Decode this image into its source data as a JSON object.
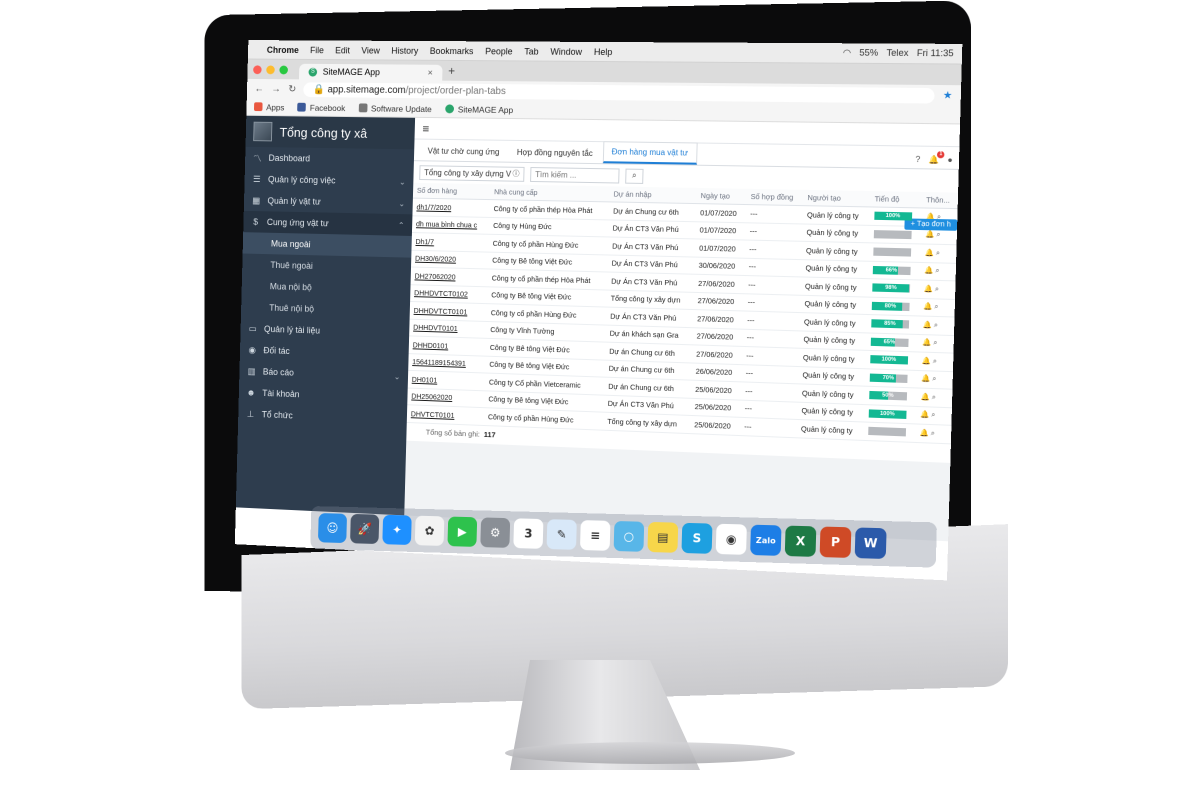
{
  "menubar": {
    "apple": "",
    "items": [
      "Chrome",
      "File",
      "Edit",
      "View",
      "History",
      "Bookmarks",
      "People",
      "Tab",
      "Window",
      "Help"
    ],
    "battery": "55%",
    "time": "Fri 11:35",
    "wifi_label": "Telex"
  },
  "browser": {
    "tab_title": "SiteMAGE App",
    "tab_close": "×",
    "new_tab": "+",
    "url_domain": "app.sitemage.com",
    "url_path": "/project/order-plan-tabs",
    "bookmarks": [
      "Apps",
      "Facebook",
      "Software Update",
      "SiteMAGE App"
    ]
  },
  "sidebar": {
    "brand": "Tổng công ty xâ",
    "items": [
      {
        "label": "Dashboard",
        "icon": "chart-line-icon"
      },
      {
        "label": "Quản lý công việc",
        "icon": "tasks-icon",
        "chevron": "⌄"
      },
      {
        "label": "Quản lý vật tư",
        "icon": "grid-icon",
        "chevron": "⌄"
      },
      {
        "label": "Cung ứng vật tư",
        "icon": "dollar-icon",
        "chevron": "⌃"
      }
    ],
    "subitems": [
      "Mua ngoài",
      "Thuê ngoài",
      "Mua nội bộ",
      "Thuê nội bộ"
    ],
    "items2": [
      {
        "label": "Quản lý tài liệu",
        "icon": "document-icon"
      },
      {
        "label": "Đối tác",
        "icon": "user-circle-icon"
      },
      {
        "label": "Báo cáo",
        "icon": "bar-chart-icon",
        "chevron": "⌄"
      },
      {
        "label": "Tài khoản",
        "icon": "users-icon"
      },
      {
        "label": "Tổ chức",
        "icon": "sitemap-icon"
      }
    ]
  },
  "main": {
    "tabs": [
      "Vật tư chờ cung ứng",
      "Hợp đồng nguyên tắc",
      "Đơn hàng mua vật tư"
    ],
    "filter_select": "Tổng công ty xây dựng V",
    "search_placeholder": "Tìm kiếm ...",
    "create_button": "+ Tạo đơn h",
    "columns": [
      "Số đơn hàng",
      "Nhà cung cấp",
      "Dự án nhập",
      "Ngày tạo",
      "Số hợp đồng",
      "Người tạo",
      "Tiến độ",
      "Thôn..."
    ],
    "rows": [
      {
        "code": "dh1/7/2020",
        "supplier": "Công ty cổ phần thép Hòa Phát",
        "project": "Dự án Chung cư 6th",
        "date": "01/07/2020",
        "contract": "---",
        "creator": "Quản lý công ty",
        "progress": 100,
        "progress_label": "100%"
      },
      {
        "code": "dh mua bình chua c",
        "supplier": "Công ty Hùng Đức",
        "project": "Dự Án CT3 Văn Phú",
        "date": "01/07/2020",
        "contract": "---",
        "creator": "Quản lý công ty",
        "progress": 0,
        "progress_label": ""
      },
      {
        "code": "Dh1/7",
        "supplier": "Công ty cổ phần Hùng Đức",
        "project": "Dự Án CT3 Văn Phú",
        "date": "01/07/2020",
        "contract": "---",
        "creator": "Quản lý công ty",
        "progress": 0,
        "progress_label": ""
      },
      {
        "code": "DH30/6/2020",
        "supplier": "Công ty Bê tông Việt Đức",
        "project": "Dự Án CT3 Văn Phú",
        "date": "30/06/2020",
        "contract": "---",
        "creator": "Quản lý công ty",
        "progress": 66,
        "progress_label": "66%"
      },
      {
        "code": "DH27062020",
        "supplier": "Công ty cổ phần thép Hòa Phát",
        "project": "Dự Án CT3 Văn Phú",
        "date": "27/06/2020",
        "contract": "---",
        "creator": "Quản lý công ty",
        "progress": 98,
        "progress_label": "98%"
      },
      {
        "code": "DHHDVTCT0102",
        "supplier": "Công ty Bê tông Việt Đức",
        "project": "Tổng công ty xây dựn",
        "date": "27/06/2020",
        "contract": "---",
        "creator": "Quản lý công ty",
        "progress": 80,
        "progress_label": "80%"
      },
      {
        "code": "DHHDVTCT0101",
        "supplier": "Công ty cổ phần Hùng Đức",
        "project": "Dự Án CT3 Văn Phú",
        "date": "27/06/2020",
        "contract": "---",
        "creator": "Quản lý công ty",
        "progress": 85,
        "progress_label": "85%"
      },
      {
        "code": "DHHDVT0101",
        "supplier": "Công ty Vĩnh Tường",
        "project": "Dự án khách sạn Gra",
        "date": "27/06/2020",
        "contract": "---",
        "creator": "Quản lý công ty",
        "progress": 65,
        "progress_label": "65%"
      },
      {
        "code": "DHHD0101",
        "supplier": "Công ty Bê tông Việt Đức",
        "project": "Dự án Chung cư 6th",
        "date": "27/06/2020",
        "contract": "---",
        "creator": "Quản lý công ty",
        "progress": 100,
        "progress_label": "100%"
      },
      {
        "code": "15641189154391",
        "supplier": "Công ty Bê tông Việt Đức",
        "project": "Dự án Chung cư 6th",
        "date": "26/06/2020",
        "contract": "---",
        "creator": "Quản lý công ty",
        "progress": 70,
        "progress_label": "70%"
      },
      {
        "code": "DH0101",
        "supplier": "Công ty Cổ phần Vietceramic",
        "project": "Dự án Chung cư 6th",
        "date": "25/06/2020",
        "contract": "---",
        "creator": "Quản lý công ty",
        "progress": 50,
        "progress_label": "50%"
      },
      {
        "code": "DH25062020",
        "supplier": "Công ty Bê tông Việt Đức",
        "project": "Dự Án CT3 Văn Phú",
        "date": "25/06/2020",
        "contract": "---",
        "creator": "Quản lý công ty",
        "progress": 100,
        "progress_label": "100%"
      },
      {
        "code": "DHVTCT0101",
        "supplier": "Công ty cổ phần Hùng Đức",
        "project": "Tổng công ty xây dựn",
        "date": "25/06/2020",
        "contract": "---",
        "creator": "Quản lý công ty",
        "progress": 0,
        "progress_label": ""
      }
    ],
    "footer_label": "Tổng số bản ghi:",
    "footer_value": "117"
  },
  "colors": {
    "sidebar": "#2e3d4e",
    "progress": "#13b893",
    "accent": "#1f7fd6"
  },
  "dock": [
    {
      "name": "finder-icon",
      "bg": "#2a8ee8",
      "glyph": "☺"
    },
    {
      "name": "launchpad-icon",
      "bg": "#4a5668",
      "glyph": "🚀"
    },
    {
      "name": "safari-icon",
      "bg": "#1e90ff",
      "glyph": "✦"
    },
    {
      "name": "photos-icon",
      "bg": "#f3f3f3",
      "glyph": "✿"
    },
    {
      "name": "facetime-icon",
      "bg": "#2ec24d",
      "glyph": "▶"
    },
    {
      "name": "settings-icon",
      "bg": "#8a8f96",
      "glyph": "⚙"
    },
    {
      "name": "calendar-icon",
      "bg": "#ffffff",
      "glyph": "3"
    },
    {
      "name": "preview-icon",
      "bg": "#d8e8f8",
      "glyph": "✎"
    },
    {
      "name": "reminders-icon",
      "bg": "#ffffff",
      "glyph": "≡"
    },
    {
      "name": "app-icon",
      "bg": "#58b6e8",
      "glyph": "○"
    },
    {
      "name": "notes-icon",
      "bg": "#f7d64a",
      "glyph": "▤"
    },
    {
      "name": "skype-icon",
      "bg": "#1ea0e0",
      "glyph": "S"
    },
    {
      "name": "chrome-icon",
      "bg": "#ffffff",
      "glyph": "◉"
    },
    {
      "name": "zalo-icon",
      "bg": "#1d7ee6",
      "glyph": "Zalo"
    },
    {
      "name": "excel-icon",
      "bg": "#1e7a45",
      "glyph": "X"
    },
    {
      "name": "powerpoint-icon",
      "bg": "#cf4a26",
      "glyph": "P"
    },
    {
      "name": "word-icon",
      "bg": "#2b5aaa",
      "glyph": "W"
    }
  ]
}
